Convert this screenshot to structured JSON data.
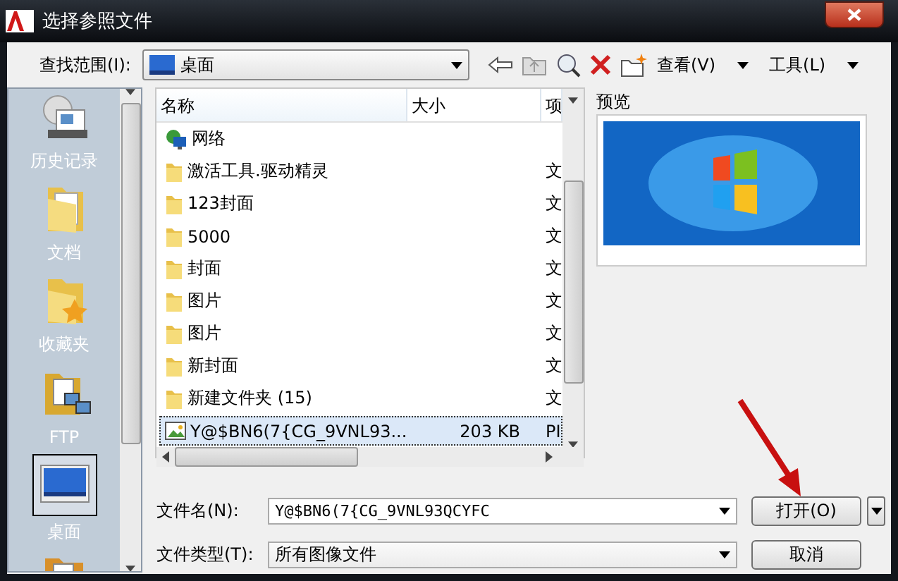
{
  "window": {
    "title": "选择参照文件"
  },
  "toolbar": {
    "look_in_label": "查找范围(I):",
    "look_in_value": "桌面",
    "views_label": "查看(V)",
    "tools_label": "工具(L)"
  },
  "places": [
    {
      "kind": "history",
      "label": "历史记录",
      "selected": false
    },
    {
      "kind": "documents",
      "label": "文档",
      "selected": false
    },
    {
      "kind": "favorites",
      "label": "收藏夹",
      "selected": false
    },
    {
      "kind": "ftp",
      "label": "FTP",
      "selected": false
    },
    {
      "kind": "desktop",
      "label": "桌面",
      "selected": true
    },
    {
      "kind": "folder",
      "selected": false
    }
  ],
  "file_list": {
    "columns": [
      "名称",
      "大小",
      "项"
    ],
    "rows": [
      {
        "kind": "network",
        "name": "网络",
        "selected": false
      },
      {
        "kind": "folder",
        "name": "激活工具.驱动精灵",
        "type": "文",
        "selected": false
      },
      {
        "kind": "folder",
        "name": "123封面",
        "type": "文",
        "selected": false
      },
      {
        "kind": "folder",
        "name": "5000",
        "type": "文",
        "selected": false
      },
      {
        "kind": "folder",
        "name": "封面",
        "type": "文",
        "selected": false
      },
      {
        "kind": "folder",
        "name": "图片",
        "type": "文",
        "selected": false
      },
      {
        "kind": "folder",
        "name": "图片",
        "type": "文",
        "selected": false
      },
      {
        "kind": "folder",
        "name": "新封面",
        "type": "文",
        "selected": false
      },
      {
        "kind": "folder",
        "name": "新建文件夹 (15)",
        "type": "文",
        "selected": false
      },
      {
        "kind": "image",
        "name": "Y@$BN6(7{CG_9VNL93...",
        "size": "203 KB",
        "type": "PI",
        "selected": true
      }
    ]
  },
  "preview": {
    "label": "预览"
  },
  "file_name": {
    "label": "文件名(N):",
    "value": "Y@$BN6(7{CG_9VNL93QCYFC"
  },
  "file_type": {
    "label": "文件类型(T):",
    "value": "所有图像文件"
  },
  "buttons": [
    {
      "kind": "open",
      "label": "打开(O)"
    },
    {
      "kind": "cancel",
      "label": "取消"
    }
  ]
}
